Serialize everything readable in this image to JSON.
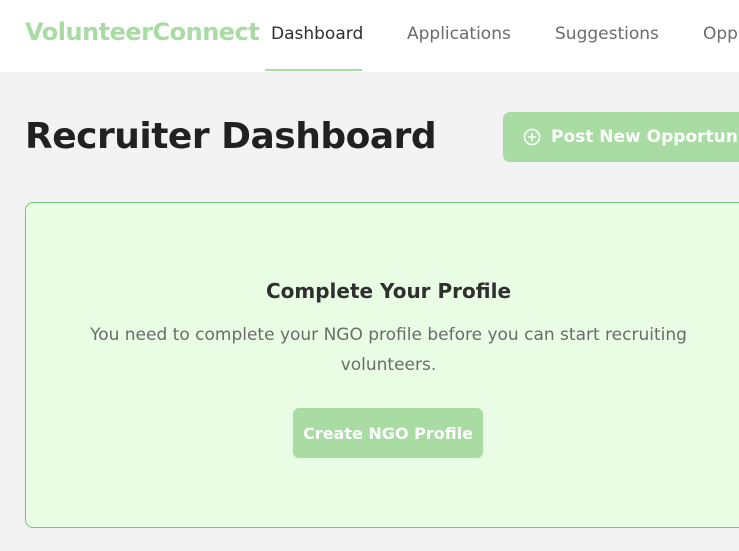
{
  "navbar": {
    "brand": "VolunteerConnect",
    "items": [
      {
        "label": "Dashboard",
        "active": true
      },
      {
        "label": "Applications",
        "active": false
      },
      {
        "label": "Suggestions",
        "active": false
      },
      {
        "label": "Opportunities",
        "active": false
      }
    ]
  },
  "header": {
    "title": "Recruiter Dashboard",
    "post_button_label": "Post New Opportunity",
    "post_button_icon": "plus-circle-icon"
  },
  "profile_prompt": {
    "title": "Complete Your Profile",
    "message": "You need to complete your NGO profile before you can start recruiting volunteers.",
    "button_label": "Create NGO Profile"
  },
  "colors": {
    "accent": "#a8dca3",
    "card_background": "#e9fde4",
    "card_border": "#7bc47a",
    "page_background": "#f3f3f3",
    "text_dark": "#212121",
    "text_muted": "#6b6b6b"
  }
}
